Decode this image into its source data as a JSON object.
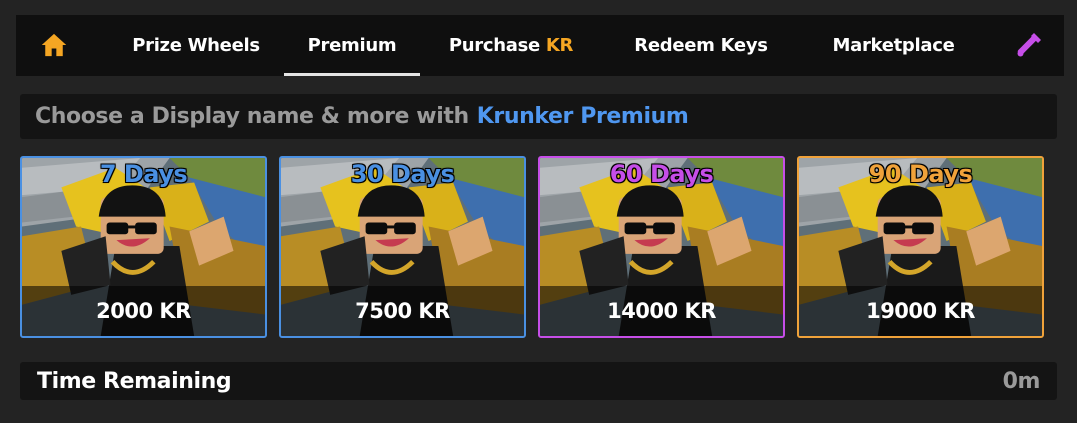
{
  "nav": {
    "tabs": [
      {
        "label": "Prize Wheels"
      },
      {
        "label": "Premium",
        "active": true
      },
      {
        "label": "Purchase",
        "suffix": "KR"
      },
      {
        "label": "Redeem Keys"
      },
      {
        "label": "Marketplace"
      }
    ],
    "home_icon": "home-icon",
    "editor_icon": "wrench-icon"
  },
  "promo": {
    "text": "Choose a Display name & more with",
    "highlight": "Krunker Premium"
  },
  "cards": [
    {
      "days": "7 Days",
      "price": "2000 KR",
      "color": "#4a90e2"
    },
    {
      "days": "30 Days",
      "price": "7500 KR",
      "color": "#4a90e2"
    },
    {
      "days": "60 Days",
      "price": "14000 KR",
      "color": "#c64ee8"
    },
    {
      "days": "90 Days",
      "price": "19000 KR",
      "color": "#f0a23a"
    }
  ],
  "timer": {
    "label": "Time Remaining",
    "value": "0m"
  },
  "colors": {
    "accent_blue": "#4f97f0",
    "kr_gold": "#f5a623",
    "purple": "#c64ee8",
    "orange": "#f0a23a"
  }
}
